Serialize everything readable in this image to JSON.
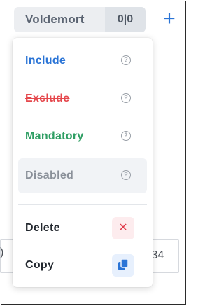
{
  "tag": {
    "name": "Voldemort",
    "counts": "0|0",
    "add_icon": "+"
  },
  "background_row": {
    "left_fragment": ")",
    "right_fragment": ":34"
  },
  "menu": {
    "items": [
      {
        "label": "Include",
        "color": "#2a74d6",
        "help_icon": "?"
      },
      {
        "label": "Exclude",
        "color": "#e5484d",
        "help_icon": "?"
      },
      {
        "label": "Mandatory",
        "color": "#2e9e63",
        "help_icon": "?"
      },
      {
        "label": "Disabled",
        "color": "#8a9099",
        "help_icon": "?"
      }
    ],
    "actions": {
      "delete_label": "Delete",
      "copy_label": "Copy"
    }
  },
  "colors": {
    "accent": "#2a74d6",
    "danger": "#e03b4a"
  }
}
